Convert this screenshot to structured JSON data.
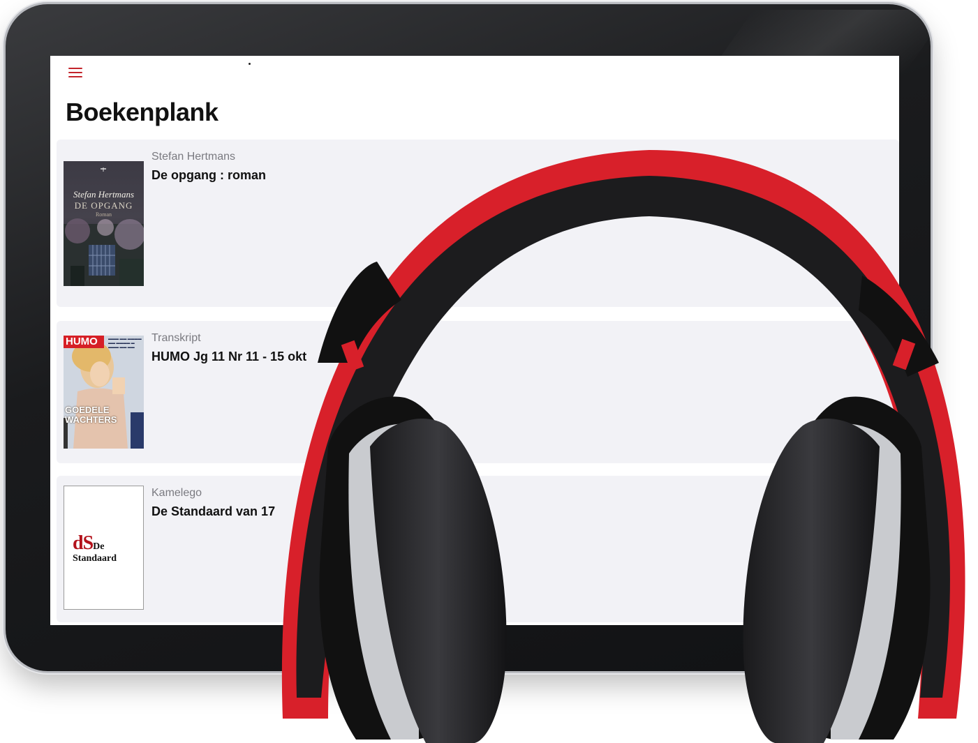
{
  "header": {
    "menu_icon": "hamburger-menu-icon",
    "title": "Boekenplank"
  },
  "books": [
    {
      "author": "Stefan Hertmans",
      "title": "De opgang : roman",
      "cover": {
        "author": "Stefan Hertmans",
        "title": "DE OPGANG",
        "subtitle": "Roman"
      }
    },
    {
      "author": "Transkript",
      "title": "HUMO Jg 11 Nr 11 - 15 okt",
      "cover": {
        "logo": "HUMO",
        "headline": "GOEDELE\nWACHTERS"
      }
    },
    {
      "author": "Kamelego",
      "title": "De Standaard van 17",
      "cover": {
        "logo_big": "dS",
        "logo_small": "De",
        "logo_line2": "Standaard"
      }
    }
  ],
  "colors": {
    "accent": "#c3242b",
    "card_bg": "#f2f2f6",
    "headphone_red": "#e0262d"
  }
}
